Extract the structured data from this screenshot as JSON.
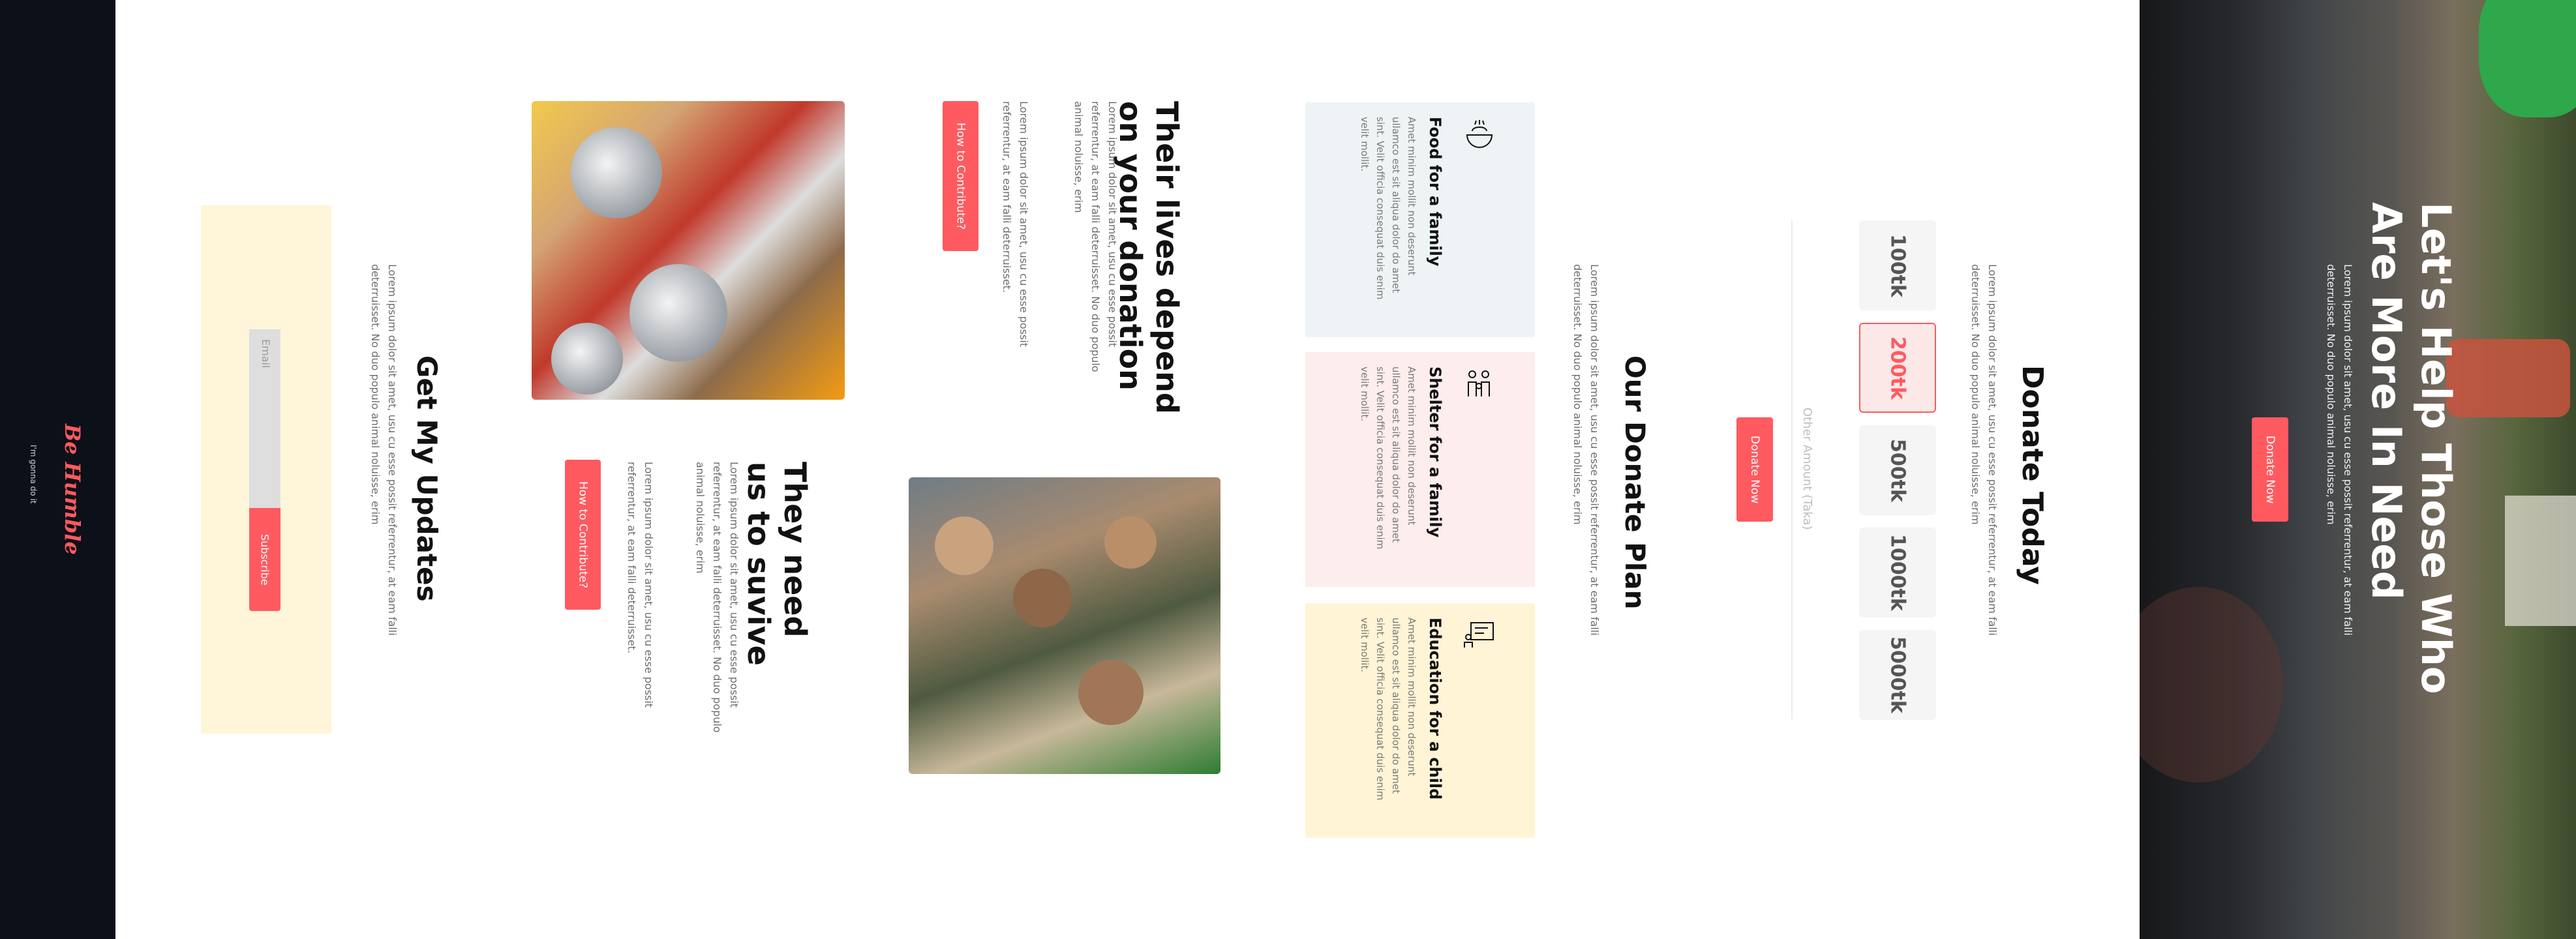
{
  "brand": {
    "name": "Be Humble",
    "tagline": "I'm gonna do it"
  },
  "hero": {
    "title": "Let's Help Those Who Are More In Need",
    "description": "Lorem ipsum dolor sit amet, usu cu esse possit referrentur, at eam falli deterruisset. No duo populo animal noluisse, erim",
    "cta_label": "Donate Now"
  },
  "donate_today": {
    "title": "Donate Today",
    "description": "Lorem ipsum dolor sit amet, usu cu esse possit referrentur, at eam falli deterruisset. No duo populo animal noluisse, erim",
    "amounts": [
      "100tk",
      "200tk",
      "500tk",
      "1000tk",
      "5000tk"
    ],
    "selected_amount": "200tk",
    "other_amount_placeholder": "Other Amount (Taka)",
    "cta_label": "Donate Now"
  },
  "donate_plan": {
    "title": "Our Donate Plan",
    "description": "Lorem ipsum dolor sit amet, usu cu esse possit referrentur, at eam falli deterruisset. No duo populo animal noluisse, erim",
    "cards": [
      {
        "title": "Food for a family",
        "text": "Amet minim mollit non deserunt ullamco est sit aliqua dolor do amet sint. Velit officia consequat duis enim velit mollit.",
        "icon": "food-bowl-icon",
        "color": "#eef3f5"
      },
      {
        "title": "Shelter for a family",
        "text": "Amet minim mollit non deserunt ullamco est sit aliqua dolor do amet sint. Velit officia consequat duis enim velit mollit.",
        "icon": "family-shelter-icon",
        "color": "#fdeded"
      },
      {
        "title": "Education for a child",
        "text": "Amet minim mollit non deserunt ullamco est sit aliqua dolor do amet sint. Velit officia consequat duis enim velit mollit.",
        "icon": "education-board-icon",
        "color": "#fff4d6"
      }
    ]
  },
  "story": {
    "lives": {
      "title": "Their lives depend on your donation",
      "p1": "Lorem ipsum dolor sit amet, usu cu esse possit referrentur, at eam falli deterruisset. No duo populo animal noluisse, erim",
      "p2": "Lorem ipsum dolor sit amet, usu cu esse possit referrentur, at eam falli deterruisset.",
      "cta_label": "How to Contribute?"
    },
    "survive": {
      "title": "They need us to suvive",
      "p1": "Lorem ipsum dolor sit amet, usu cu esse possit referrentur, at eam falli deterruisset. No duo populo animal noluisse, erim",
      "p2": "Lorem ipsum dolor sit amet, usu cu esse possit referrentur, at eam falli deterruisset.",
      "cta_label": "How to Contribute?"
    }
  },
  "updates": {
    "title": "Get My Updates",
    "description": "Lorem ipsum dolor sit amet, usu cu esse possit referrentur, at eam falli deterruisset. No duo populo animal noluisse, erim",
    "email_placeholder": "Email",
    "subscribe_label": "Subscribe"
  },
  "colors": {
    "accent": "#ff5a5f",
    "footer": "#0c1019",
    "newsletter_bg": "#fff5d9"
  }
}
